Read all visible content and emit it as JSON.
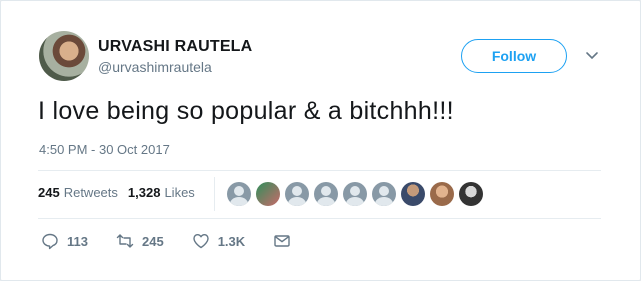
{
  "author": {
    "name": "URVASHI RAUTELA",
    "handle": "@urvashimrautela"
  },
  "follow_button": {
    "label": "Follow"
  },
  "tweet": {
    "text": "I love being so popular & a bitchhh!!!",
    "timestamp": "4:50 PM - 30 Oct 2017"
  },
  "stats": {
    "retweets_count": "245",
    "retweets_label": "Retweets",
    "likes_count": "1,328",
    "likes_label": "Likes"
  },
  "likers": [
    {
      "icon": "default-avatar-icon"
    },
    {
      "icon": "user-avatar-icon"
    },
    {
      "icon": "default-avatar-icon"
    },
    {
      "icon": "default-avatar-icon"
    },
    {
      "icon": "default-avatar-icon"
    },
    {
      "icon": "default-avatar-icon"
    },
    {
      "icon": "user-avatar-icon"
    },
    {
      "icon": "user-avatar-icon"
    },
    {
      "icon": "user-avatar-icon"
    }
  ],
  "actions": {
    "replies": "113",
    "retweets": "245",
    "likes": "1.3K"
  },
  "colors": {
    "accent": "#1da1f2",
    "muted": "#657786",
    "text": "#14171a"
  }
}
